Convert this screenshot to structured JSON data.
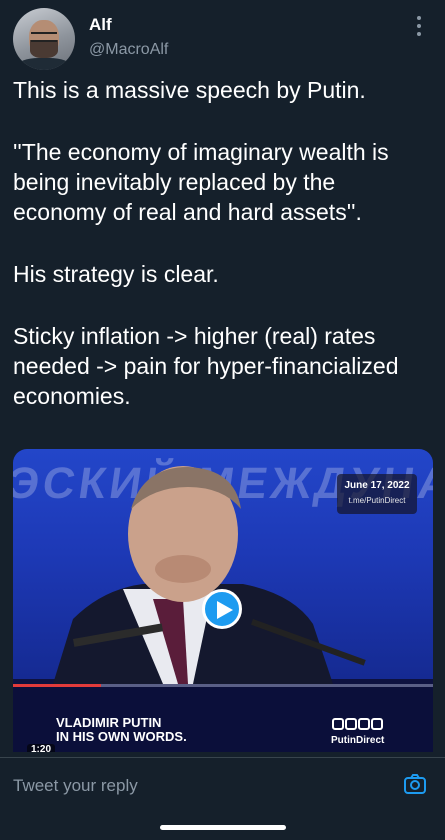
{
  "author": {
    "name": "Alf",
    "handle": "@MacroAlf"
  },
  "tweet": {
    "paragraphs": [
      "This is a massive speech by Putin.",
      "''The economy of imaginary wealth is being inevitably replaced by the economy of real and hard assets''.",
      "His strategy is clear.",
      "Sticky inflation -> higher (real) rates needed -> pain for hyper-financialized economies."
    ]
  },
  "video": {
    "date": "June 17, 2022",
    "channel": "t.me/PutinDirect",
    "speaker_line1": "VLADIMIR PUTIN",
    "speaker_line2": "IN HIS OWN WORDS.",
    "brand": "PutinDirect",
    "duration": "1:20",
    "progress_fraction": 0.21
  },
  "reply": {
    "placeholder": "Tweet your reply"
  },
  "colors": {
    "background": "#15202b",
    "accent": "#1d9bf0",
    "muted": "#8b98a5"
  },
  "icons": [
    "more-icon",
    "play-icon",
    "camera-icon"
  ]
}
